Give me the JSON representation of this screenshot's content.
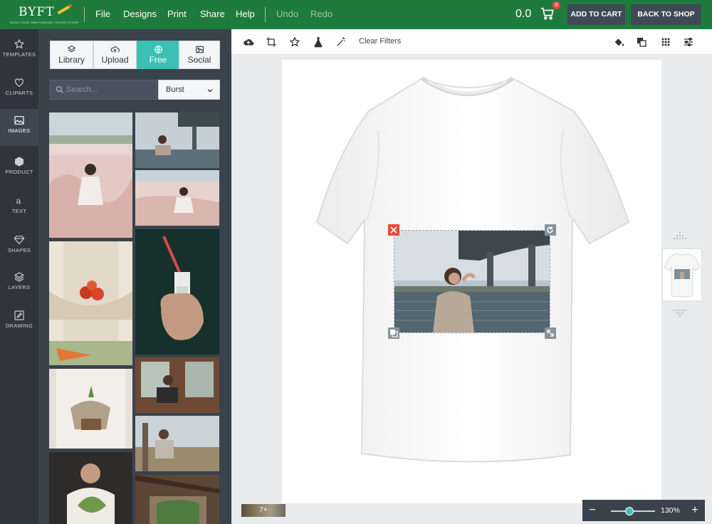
{
  "brand": {
    "name": "BYFT",
    "tagline": "BUILD YOUR OWN FASHION TRENDS STORE"
  },
  "menu": {
    "file": "File",
    "designs": "Designs",
    "print": "Print",
    "share": "Share",
    "help": "Help",
    "undo": "Undo",
    "redo": "Redo"
  },
  "cart": {
    "price": "0.0",
    "count": "0",
    "add_to_cart": "ADD TO CART",
    "back_to_shop": "BACK TO SHOP"
  },
  "rail": {
    "items": [
      {
        "label": "TEMPLATES",
        "icon": "star-icon"
      },
      {
        "label": "CLIPARTS",
        "icon": "heart-icon"
      },
      {
        "label": "IMAGES",
        "icon": "image-icon"
      },
      {
        "label": "PRODUCT",
        "icon": "cube-icon"
      },
      {
        "label": "TEXT",
        "icon": "text-icon"
      },
      {
        "label": "SHAPES",
        "icon": "diamond-icon"
      },
      {
        "label": "LAYERS",
        "icon": "layers-icon"
      },
      {
        "label": "DRAWING",
        "icon": "pencil-icon"
      }
    ],
    "active": "IMAGES"
  },
  "panel": {
    "tabs": [
      {
        "label": "Library",
        "icon": "stack-icon"
      },
      {
        "label": "Upload",
        "icon": "cloud-upload-icon"
      },
      {
        "label": "Free",
        "icon": "globe-icon"
      },
      {
        "label": "Social",
        "icon": "photo-icon"
      }
    ],
    "active_tab": "Free",
    "search_placeholder": "Search...",
    "source_selected": "Burst"
  },
  "toolbar": {
    "clear_filters": "Clear Filters"
  },
  "canvas": {
    "color_chip_label": "7+"
  },
  "zoom": {
    "minus": "−",
    "plus": "+",
    "value": "130%",
    "level_percent": 130
  },
  "colors": {
    "topbar": "#1f7a3d",
    "accent": "#3cc0b4",
    "rail": "#2e353f",
    "panel": "#3a424c",
    "delete": "#e74c3c"
  }
}
